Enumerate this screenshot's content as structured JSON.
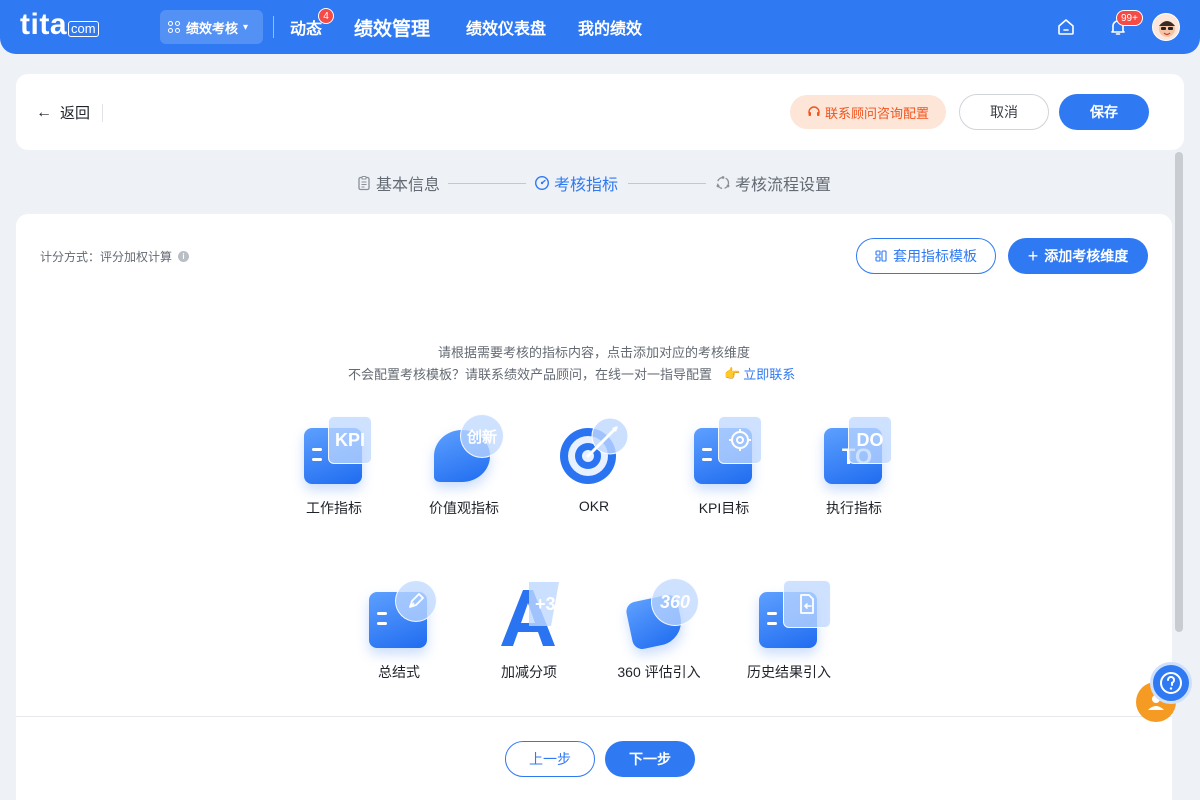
{
  "topbar": {
    "logo_word": "tita",
    "logo_domain": "com",
    "module_label": "绩效考核",
    "nav": [
      "动态",
      "绩效管理",
      "绩效仪表盘",
      "我的绩效"
    ],
    "dynamic_badge": "4",
    "notification_badge": "99+",
    "accent_color": "#2f79f3"
  },
  "header": {
    "back_label": "返回",
    "consult_label": "联系顾问咨询配置",
    "cancel_label": "取消",
    "save_label": "保存"
  },
  "steps": [
    {
      "label": "基本信息",
      "icon": "clipboard-icon",
      "active": false
    },
    {
      "label": "考核指标",
      "icon": "gauge-icon",
      "active": true
    },
    {
      "label": "考核流程设置",
      "icon": "flow-icon",
      "active": false
    }
  ],
  "main": {
    "score_label": "计分方式：评分加权计算",
    "template_button": "套用指标模板",
    "add_button": "添加考核维度",
    "hint_line1": "请根据需要考核的指标内容，点击添加对应的考核维度",
    "hint_line2": "不会配置考核模板？请联系绩效产品顾问，在线一对一指导配置",
    "contact_link": "立即联系",
    "tiles_row1": [
      {
        "label": "工作指标",
        "badge": "KPI"
      },
      {
        "label": "价值观指标",
        "badge": "创新"
      },
      {
        "label": "OKR",
        "badge": ""
      },
      {
        "label": "KPI目标",
        "badge": ""
      },
      {
        "label": "执行指标",
        "badge": "DO"
      }
    ],
    "tiles_row2": [
      {
        "label": "总结式",
        "badge": ""
      },
      {
        "label": "加减分项",
        "badge": "+3"
      },
      {
        "label": "360 评估引入",
        "badge": "360"
      },
      {
        "label": "历史结果引入",
        "badge": ""
      }
    ]
  },
  "footer": {
    "prev_label": "上一步",
    "next_label": "下一步"
  }
}
